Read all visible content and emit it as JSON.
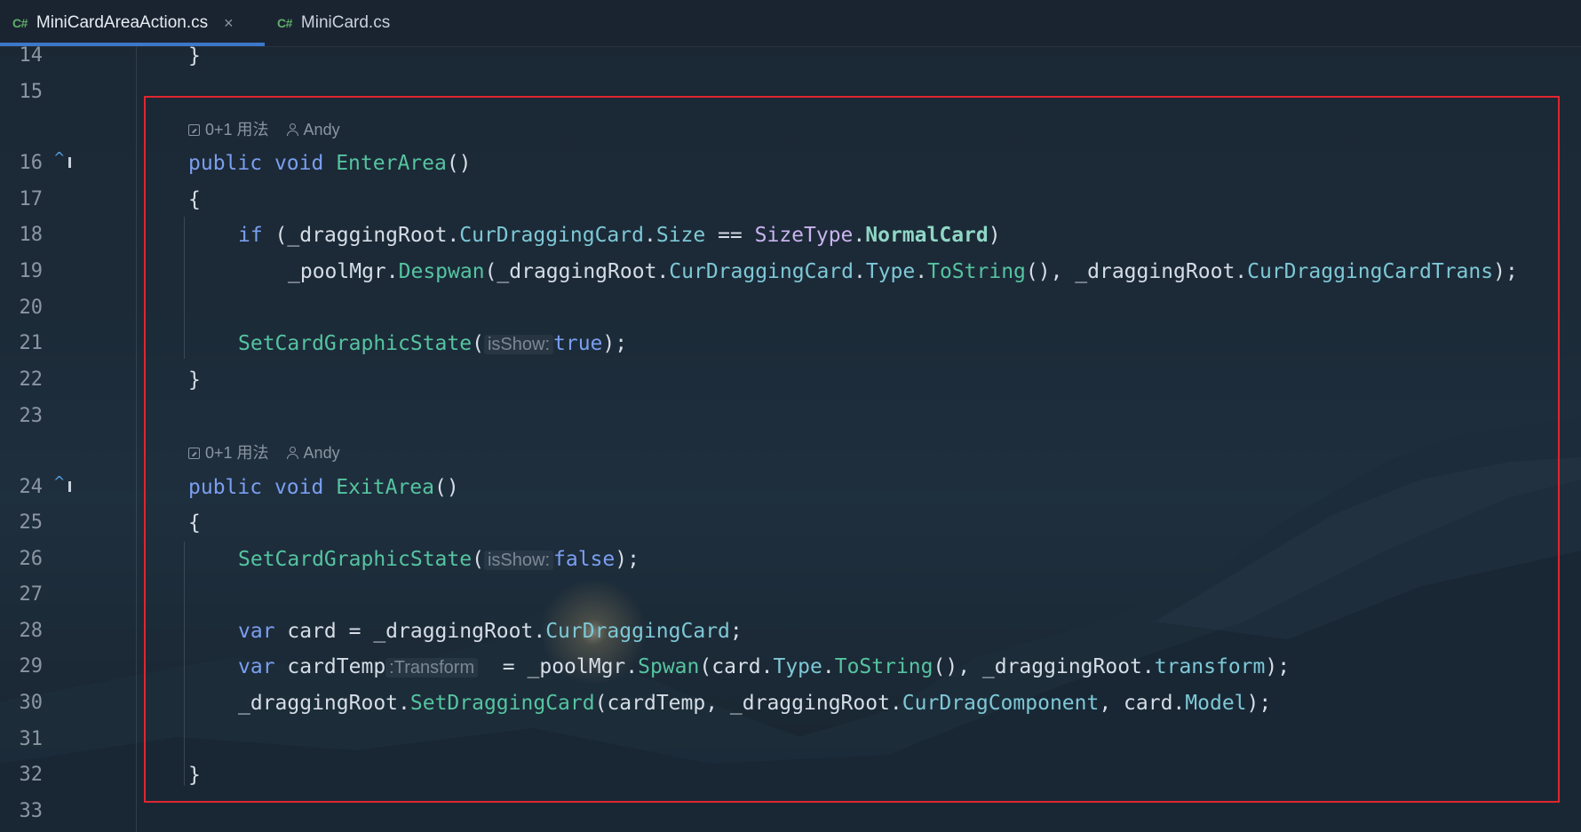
{
  "tabs": [
    {
      "lang": "C#",
      "label": "MiniCardAreaAction.cs",
      "active": true,
      "close": "×"
    },
    {
      "lang": "C#",
      "label": "MiniCard.cs",
      "active": false
    }
  ],
  "lens": {
    "usages": "0+1 用法",
    "author": "Andy"
  },
  "lines": [
    {
      "n": "14"
    },
    {
      "n": "15"
    },
    {
      "n": "16"
    },
    {
      "n": "17"
    },
    {
      "n": "18"
    },
    {
      "n": "19"
    },
    {
      "n": "20"
    },
    {
      "n": "21"
    },
    {
      "n": "22"
    },
    {
      "n": "23"
    },
    {
      "n": "24"
    },
    {
      "n": "25"
    },
    {
      "n": "26"
    },
    {
      "n": "27"
    },
    {
      "n": "28"
    },
    {
      "n": "29"
    },
    {
      "n": "30"
    },
    {
      "n": "31"
    },
    {
      "n": "32"
    },
    {
      "n": "33"
    }
  ],
  "code": {
    "l14": "}",
    "l16_kw1": "public",
    "l16_kw2": "void",
    "l16_fn": "EnterArea",
    "l16_rest": "()",
    "l17": "{",
    "l18_kw": "if",
    "l18_a": " (_draggingRoot.",
    "l18_f1": "CurDraggingCard",
    "l18_dot": ".",
    "l18_f2": "Size",
    "l18_eq": " == ",
    "l18_type": "SizeType",
    "l18_dot2": ".",
    "l18_enum": "NormalCard",
    "l18_end": ")",
    "l19_a": "_poolMgr.",
    "l19_fn": "Despwan",
    "l19_b": "(_draggingRoot.",
    "l19_f1": "CurDraggingCard",
    "l19_c": ".",
    "l19_f2": "Type",
    "l19_d": ".",
    "l19_fn2": "ToString",
    "l19_e": "(), _draggingRoot.",
    "l19_f3": "CurDraggingCardTrans",
    "l19_end": ");",
    "l21_fn": "SetCardGraphicState",
    "l21_open": "(",
    "l21_hint": "isShow:",
    "l21_val": "true",
    "l21_end": ");",
    "l22": "}",
    "l24_kw1": "public",
    "l24_kw2": "void",
    "l24_fn": "ExitArea",
    "l24_rest": "()",
    "l25": "{",
    "l26_fn": "SetCardGraphicState",
    "l26_open": "(",
    "l26_hint": "isShow:",
    "l26_val": "false",
    "l26_end": ");",
    "l28_kw": "var",
    "l28_a": " card = _draggingRoot.",
    "l28_f": "CurDraggingCard",
    "l28_end": ";",
    "l29_kw": "var",
    "l29_a": " cardTemp",
    "l29_hint": ":Transform",
    "l29_b": "  = _poolMgr.",
    "l29_fn": "Spwan",
    "l29_c": "(card.",
    "l29_f1": "Type",
    "l29_d": ".",
    "l29_fn2": "ToString",
    "l29_e": "(), _draggingRoot.",
    "l29_f2": "transform",
    "l29_end": ");",
    "l30_a": "_draggingRoot.",
    "l30_fn": "SetDraggingCard",
    "l30_b": "(cardTemp, _draggingRoot.",
    "l30_f1": "CurDragComponent",
    "l30_c": ", card.",
    "l30_f2": "Model",
    "l30_end": ");",
    "l32": "}"
  },
  "colors": {
    "keyword": "#7a9ff0",
    "method": "#55c4a0",
    "field": "#7ec8d6",
    "type": "#c9b3f0",
    "highlight_border": "#e0252e",
    "active_tab_underline": "#3d77c9"
  }
}
